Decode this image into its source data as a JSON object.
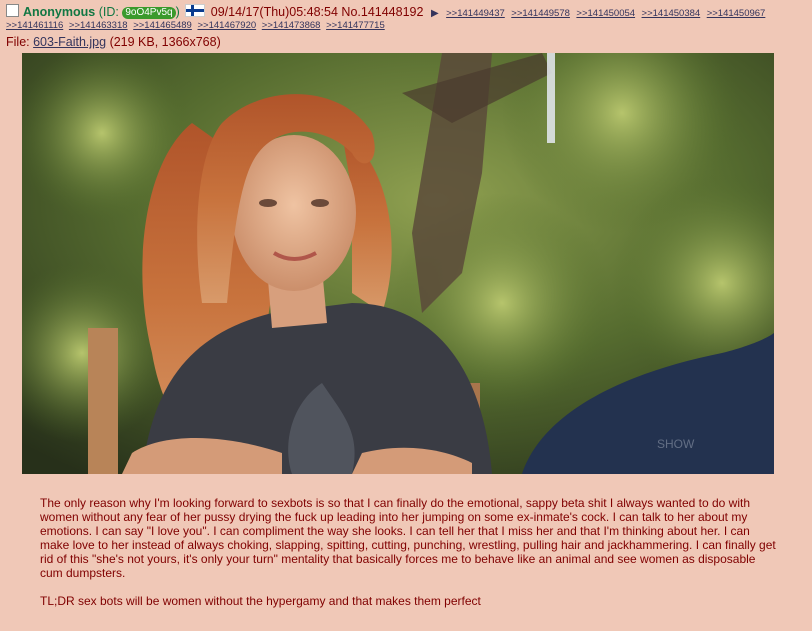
{
  "header": {
    "name": "Anonymous",
    "id_prefix": "(ID:",
    "id_value": "9oO4Pv5q",
    "id_suffix": ")",
    "flag": "finland-flag-icon",
    "datetime": "09/14/17(Thu)05:48:54",
    "post_number": "No.141448192",
    "replies_row1": [
      ">>141449437",
      ">>141449578",
      ">>141450054",
      ">>141450384",
      ">>141450967"
    ],
    "replies_row2": [
      ">>141461116",
      ">>141463318",
      ">>141465489",
      ">>141467920",
      ">>141473868",
      ">>141477715"
    ]
  },
  "file": {
    "label": "File:",
    "name": "603-Faith.jpg",
    "info": "(219 KB, 1366x768)"
  },
  "image": {
    "description_icon": "photo-woman-garden"
  },
  "message": {
    "paragraph1": "The only reason why I'm looking forward to sexbots is so that I can finally do the emotional, sappy beta shit I always wanted to do with women without any fear of her pussy drying the fuck up leading into her jumping on some ex-inmate's cock. I can talk to her about my emotions. I can say \"I love you\". I can compliment the way she looks. I can tell her that I miss her and that I'm thinking about her. I can make love to her instead of always choking, slapping, spitting, cutting, punching, wrestling, pulling hair and jackhammering. I can finally get rid of this \"she's not yours, it's only your turn\" mentality that basically forces me to behave like an animal and see women as disposable cum dumpsters.",
    "paragraph2": "TL;DR sex bots will be women without the hypergamy and that makes them perfect"
  },
  "colors": {
    "background": "#f0c8b7",
    "name": "#117743",
    "text": "#800000",
    "link": "#34345c"
  }
}
